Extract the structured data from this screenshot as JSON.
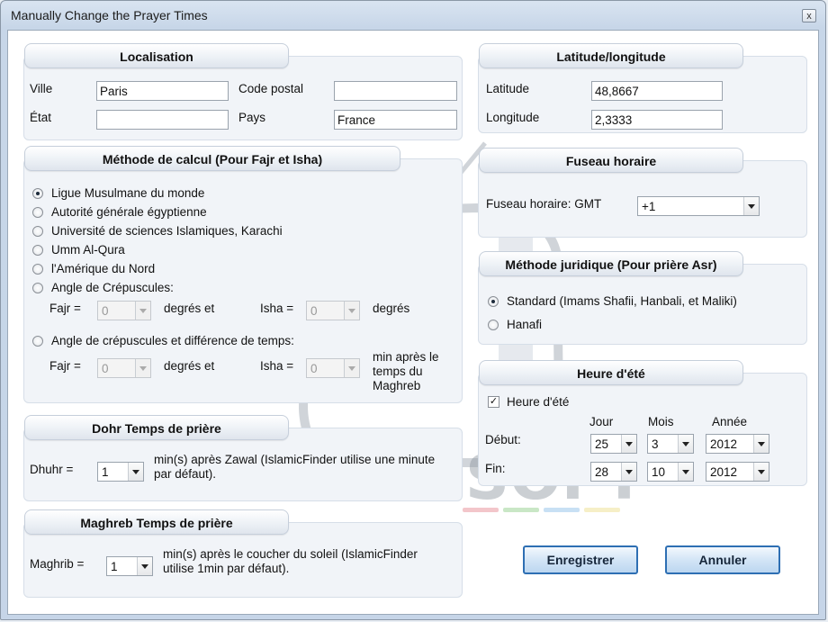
{
  "window": {
    "title": "Manually Change the Prayer Times",
    "close_glyph": "x"
  },
  "localisation": {
    "title": "Localisation",
    "ville_label": "Ville",
    "ville_value": "Paris",
    "code_postal_label": "Code postal",
    "code_postal_value": "",
    "etat_label": "État",
    "etat_value": "",
    "pays_label": "Pays",
    "pays_value": "France"
  },
  "latlong": {
    "title": "Latitude/longitude",
    "latitude_label": "Latitude",
    "latitude_value": "48,8667",
    "longitude_label": "Longitude",
    "longitude_value": "2,3333"
  },
  "methode": {
    "title": "Méthode de calcul (Pour Fajr et Isha)",
    "options": [
      "Ligue Musulmane du monde",
      "Autorité générale égyptienne",
      "Université de sciences Islamiques, Karachi",
      "Umm Al-Qura",
      "l'Amérique du Nord",
      "Angle de Crépuscules:",
      "Angle de crépuscules et différence de temps:"
    ],
    "selected_index": 0,
    "fajr_label": "Fajr =",
    "isha_label": "Isha =",
    "degres_et": "degrés et",
    "degres": "degrés",
    "min_apres_1": "min après le",
    "min_apres_2": "temps du",
    "min_apres_3": "Maghreb",
    "fajr1_value": "0",
    "isha1_value": "0",
    "fajr2_value": "0",
    "isha2_value": "0"
  },
  "fuseau": {
    "title": "Fuseau horaire",
    "label": "Fuseau horaire: GMT",
    "value": "+1"
  },
  "juridique": {
    "title": "Méthode juridique (Pour prière Asr)",
    "options": [
      "Standard (Imams Shafii, Hanbali, et Maliki)",
      "Hanafi"
    ],
    "selected_index": 0
  },
  "dohr": {
    "title": "Dohr Temps de prière",
    "label": "Dhuhr =",
    "value": "1",
    "note_1": "min(s) après Zawal (IslamicFinder utilise une minute",
    "note_2": "par défaut)."
  },
  "maghreb": {
    "title": "Maghreb Temps de prière",
    "label": "Maghrib =",
    "value": "1",
    "note_1": "min(s) après le coucher du soleil (IslamicFinder",
    "note_2": "utilise 1min par défaut)."
  },
  "ete": {
    "title": "Heure d'été",
    "checkbox_label": "Heure d'été",
    "checked": true,
    "check_glyph": "✓",
    "jour_label": "Jour",
    "mois_label": "Mois",
    "annee_label": "Année",
    "debut_label": "Début:",
    "fin_label": "Fin:",
    "debut_jour": "25",
    "debut_mois": "3",
    "debut_annee": "2012",
    "fin_jour": "28",
    "fin_mois": "10",
    "fin_annee": "2012"
  },
  "buttons": {
    "save_label": "Enregistrer",
    "cancel_label": "Annuler"
  },
  "watermark": {
    "text": "CAIROSOFT"
  },
  "colors": {
    "accent_border": "#2e6fb3",
    "group_bg": "#f1f4f8"
  }
}
